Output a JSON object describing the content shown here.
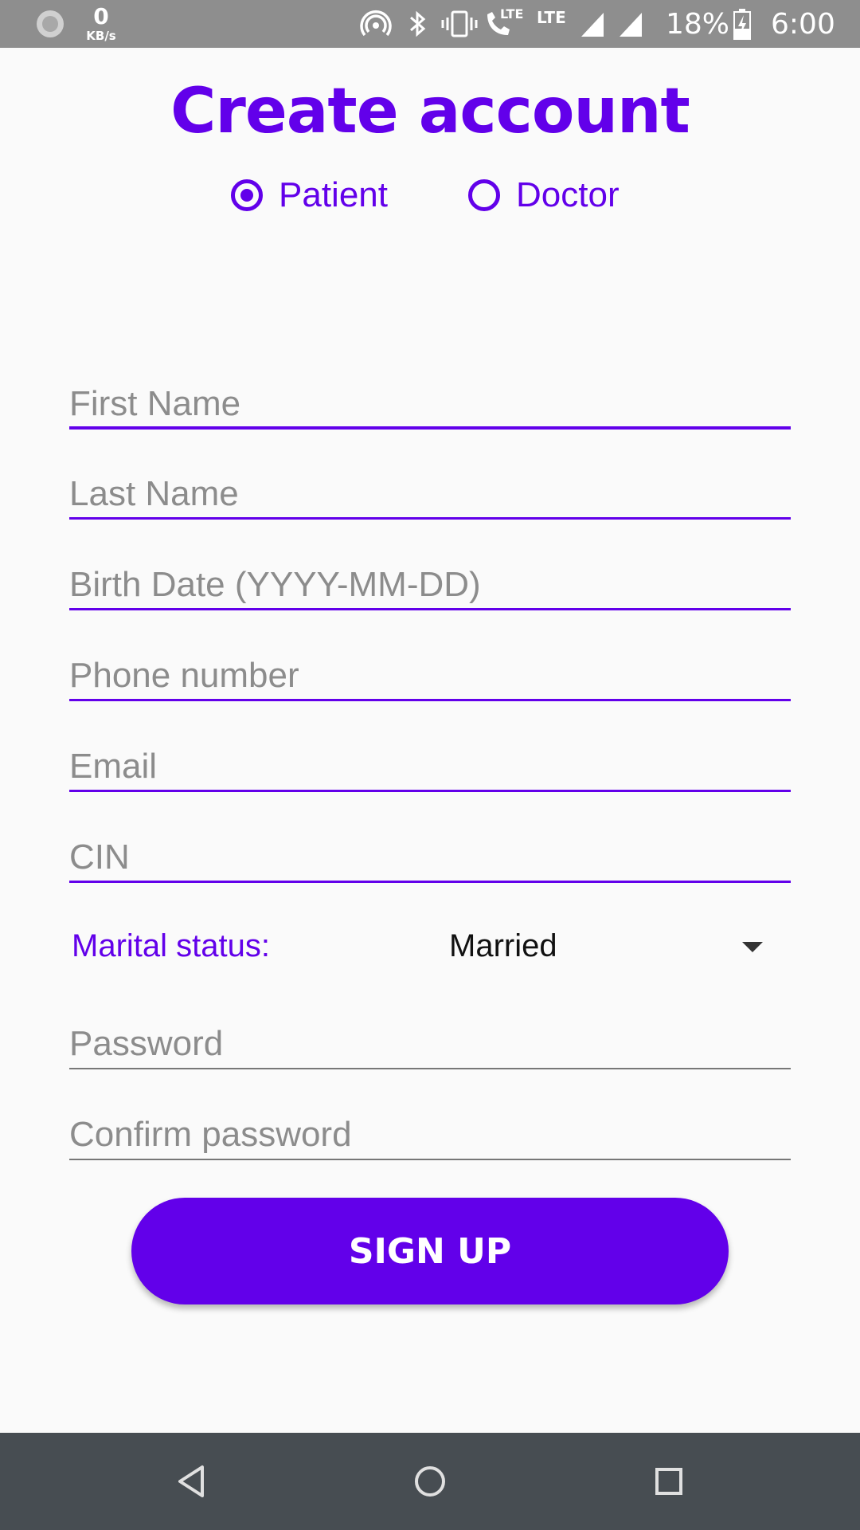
{
  "status_bar": {
    "net_speed_value": "0",
    "net_speed_unit": "KB/s",
    "lte_primary": "LTE",
    "lte_secondary": "LTE",
    "battery_percent": "18%",
    "time": "6:00",
    "icons": [
      "spinner-icon",
      "hotspot-icon",
      "bluetooth-icon",
      "vibrate-icon",
      "volte-call-icon",
      "signal-icon",
      "signal-icon",
      "battery-charging-icon"
    ]
  },
  "header": {
    "title": "Create account"
  },
  "account_type": {
    "options": [
      {
        "label": "Patient",
        "selected": true
      },
      {
        "label": "Doctor",
        "selected": false
      }
    ]
  },
  "form": {
    "first_name": {
      "value": "",
      "placeholder": "First Name"
    },
    "last_name": {
      "value": "",
      "placeholder": "Last Name"
    },
    "birth_date": {
      "value": "",
      "placeholder": "Birth Date (YYYY-MM-DD)"
    },
    "phone": {
      "value": "",
      "placeholder": "Phone number"
    },
    "email": {
      "value": "",
      "placeholder": "Email"
    },
    "cin": {
      "value": "",
      "placeholder": "CIN"
    },
    "marital_status": {
      "label": "Marital status:",
      "selected": "Married"
    },
    "password": {
      "value": "",
      "placeholder": "Password"
    },
    "confirm_password": {
      "value": "",
      "placeholder": "Confirm password"
    }
  },
  "actions": {
    "signup_label": "SIGN UP"
  },
  "nav_bar": {
    "icons": [
      "back-icon",
      "home-icon",
      "recents-icon"
    ]
  },
  "colors": {
    "accent": "#6200ea",
    "status_bar": "#8e8e8e",
    "nav_bar": "#474d52",
    "background": "#fafafa"
  }
}
